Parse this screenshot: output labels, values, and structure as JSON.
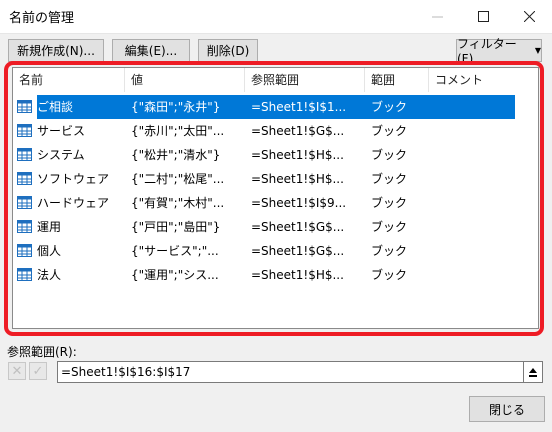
{
  "window": {
    "title": "名前の管理",
    "minimize_icon": "minimize-icon",
    "maximize_icon": "maximize-icon",
    "close_icon": "close-icon"
  },
  "toolbar": {
    "new_label": "新規作成(N)...",
    "edit_label": "編集(E)...",
    "delete_label": "削除(D)",
    "filter_label": "フィルター(F)"
  },
  "list": {
    "columns": [
      "名前",
      "値",
      "参照範囲",
      "範囲",
      "コメント"
    ],
    "rows": [
      {
        "name": "ご相談",
        "value": "{\"森田\";\"永井\"}",
        "refers": "=Sheet1!$I$1...",
        "scope": "ブック",
        "comment": ""
      },
      {
        "name": "サービス",
        "value": "{\"赤川\";\"太田\"...",
        "refers": "=Sheet1!$G$...",
        "scope": "ブック",
        "comment": ""
      },
      {
        "name": "システム",
        "value": "{\"松井\";\"清水\"}",
        "refers": "=Sheet1!$H$...",
        "scope": "ブック",
        "comment": ""
      },
      {
        "name": "ソフトウェア",
        "value": "{\"二村\";\"松尾\"...",
        "refers": "=Sheet1!$H$...",
        "scope": "ブック",
        "comment": ""
      },
      {
        "name": "ハードウェア",
        "value": "{\"有賀\";\"木村\"...",
        "refers": "=Sheet1!$I$9...",
        "scope": "ブック",
        "comment": ""
      },
      {
        "name": "運用",
        "value": "{\"戸田\";\"島田\"}",
        "refers": "=Sheet1!$G$...",
        "scope": "ブック",
        "comment": ""
      },
      {
        "name": "個人",
        "value": "{\"サービス\";\"...",
        "refers": "=Sheet1!$G$...",
        "scope": "ブック",
        "comment": ""
      },
      {
        "name": "法人",
        "value": "{\"運用\";\"シス...",
        "refers": "=Sheet1!$H$...",
        "scope": "ブック",
        "comment": ""
      }
    ],
    "selected_index": 0,
    "row_icon": "name-table-icon"
  },
  "reference": {
    "label": "参照範囲(R):",
    "value": "=Sheet1!$I$16:$I$17"
  },
  "footer": {
    "close_label": "閉じる"
  },
  "colors": {
    "highlight": "#0078d7",
    "annotation": "#ee1c25"
  }
}
